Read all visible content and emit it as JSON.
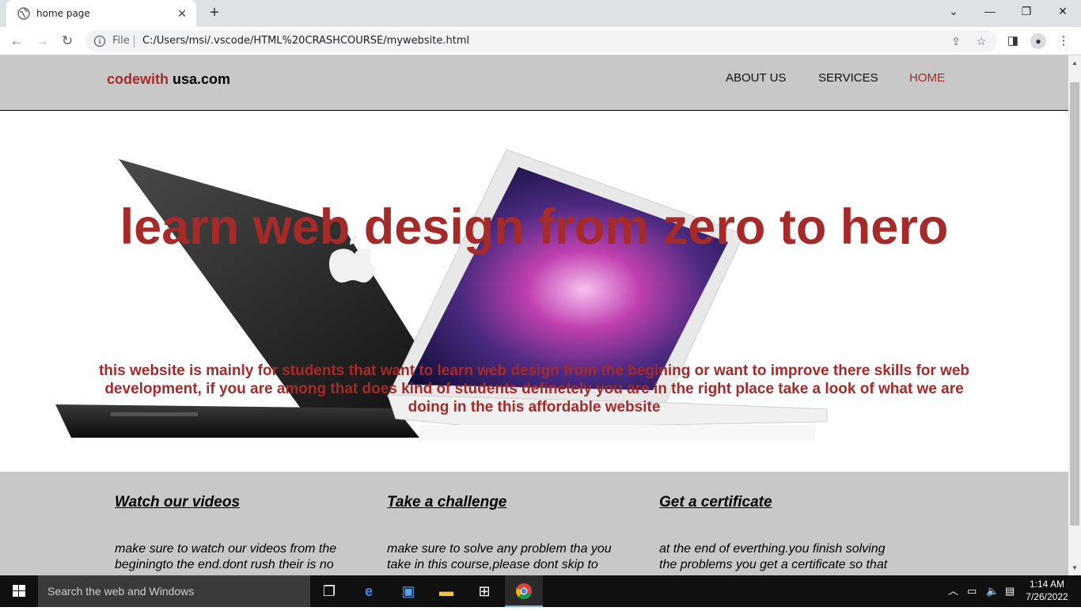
{
  "browser": {
    "tab_title": "home page",
    "address_label": "File",
    "url": "C:/Users/msi/.vscode/HTML%20CRASHCOURSE/mywebsite.html"
  },
  "site": {
    "logo_part1": "codewith",
    "logo_part2": "usa.com",
    "nav": {
      "about": "ABOUT US",
      "services": "SERVICES",
      "home": "HOME"
    },
    "hero": {
      "heading": "learn web design from zero to hero",
      "text": "this website is mainly for students that want to learn web design from the begining or want to improve there skills for web development, if you are among that does kind of students definetely you are in the right place take a look of what we are doing in the this affordable website"
    },
    "features": [
      {
        "title": "Watch our videos",
        "text": "make sure to watch our videos from the beginingto the end.dont rush their is no"
      },
      {
        "title": "Take a challenge",
        "text": "make sure to solve any problem tha you take in this course,please dont skip to"
      },
      {
        "title": "Get a certificate",
        "text": "at the end of everthing.you finish solving the problems you get a certificate so that"
      }
    ]
  },
  "taskbar": {
    "search_placeholder": "Search the web and Windows",
    "time": "1:14 AM",
    "date": "7/26/2022"
  },
  "colors": {
    "accent": "#a52a2a",
    "nav_bg": "#c8c8c8",
    "taskbar_bg": "#101010"
  }
}
